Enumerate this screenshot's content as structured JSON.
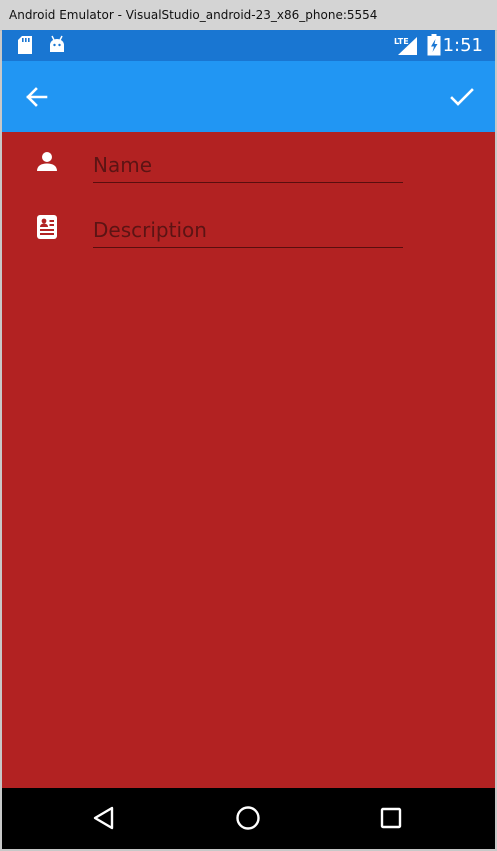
{
  "window": {
    "title": "Android Emulator - VisualStudio_android-23_x86_phone:5554"
  },
  "status_bar": {
    "time": "1:51",
    "network_label": "LTE",
    "icons": [
      "sd-card-icon",
      "android-debug-icon",
      "lte-signal-icon",
      "battery-charging-icon"
    ]
  },
  "app_bar": {
    "back_icon": "arrow-left-icon",
    "confirm_icon": "check-icon"
  },
  "form": {
    "name_placeholder": "Name",
    "name_value": "",
    "description_placeholder": "Description",
    "description_value": "",
    "name_icon": "person-icon",
    "description_icon": "contact-card-icon"
  },
  "nav_bar": {
    "icons": [
      "back-triangle-icon",
      "home-circle-icon",
      "recents-square-icon"
    ]
  },
  "colors": {
    "status_bar": "#1976d2",
    "app_bar": "#2196f3",
    "background": "#b22222",
    "placeholder": "#5c1414",
    "nav_bar": "#000000"
  }
}
